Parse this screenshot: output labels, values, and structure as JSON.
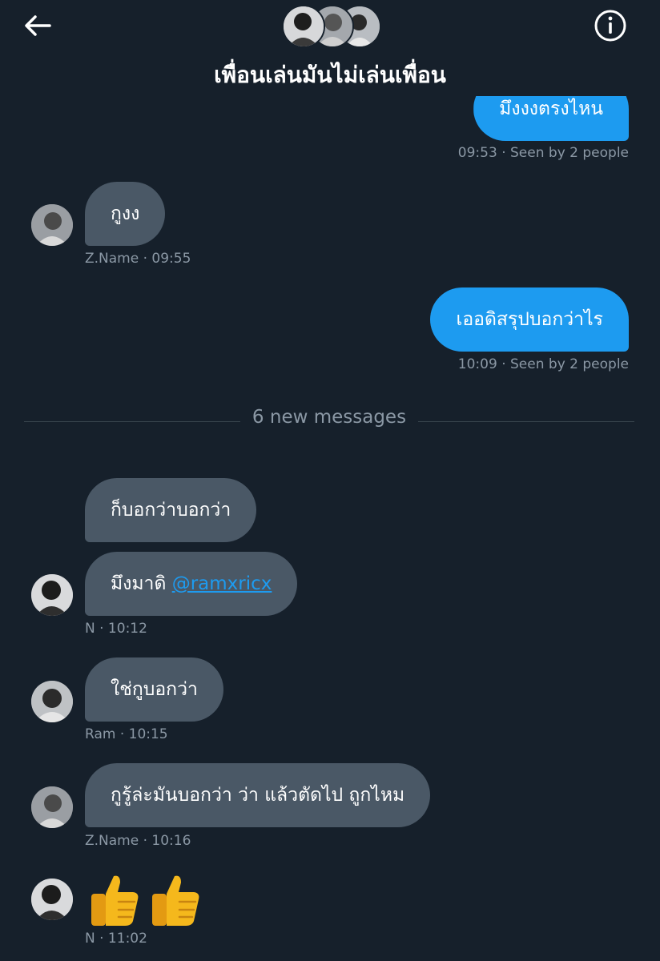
{
  "header": {
    "title": "เพื่อนเล่นมันไม่เล่นเพื่อน",
    "back_icon": "back-arrow-icon",
    "info_icon": "info-icon"
  },
  "messages": {
    "m1": {
      "text": "มึงงงตรงไหน",
      "time": "09:53",
      "status": "· Seen by 2 people"
    },
    "m2": {
      "text": "กูงง",
      "sender": "Z.Name",
      "time": "· 09:55"
    },
    "m3": {
      "text": "เออดิสรุปบอกว่าไร",
      "time": "10:09",
      "status": "· Seen by 2 people"
    },
    "m4": {
      "text": "ก็บอกว่าบอกว่า"
    },
    "m5": {
      "text": "มึงมาดิ ",
      "mention": "@ramxricx",
      "sender": "N",
      "time": "· 10:12"
    },
    "m6": {
      "text": "ใช่กูบอกว่า",
      "sender": "Ram",
      "time": "· 10:15"
    },
    "m7": {
      "text": "กูรู้ล่ะมันบอกว่า ว่า แล้วตัดไป ถูกไหม",
      "sender": "Z.Name",
      "time": "· 10:16"
    },
    "m8": {
      "emoji": "thumbs-up x2",
      "sender": "N",
      "time": "· 11:02"
    }
  },
  "divider": {
    "label": "6 new messages"
  },
  "colors": {
    "background": "#16202b",
    "outgoing_bubble": "#1d9bf0",
    "incoming_bubble": "#4a5866",
    "meta_text": "#8b98a5",
    "mention": "#1d9bf0"
  }
}
